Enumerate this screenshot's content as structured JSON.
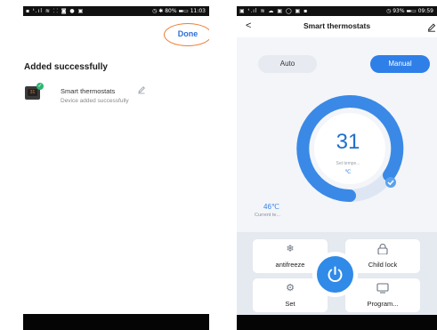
{
  "left_screen": {
    "status_left": "▪ ᵗ.ıl ≋ ⸬ ◙ ● ▣",
    "status_right": "◷ ✱ 80% ▬▭ 11:03",
    "done_label": "Done",
    "title": "Added successfully",
    "device": {
      "thumb_text": "31",
      "name": "Smart thermostats",
      "status": "Device added successfully"
    },
    "accent_color": "#ee7b32",
    "link_color": "#2f6fd6",
    "success_color": "#2bb673"
  },
  "right_screen": {
    "status_left": "▣ ᵗ.ıl ≋ ☁ ▣ ◯ ▣ ▪",
    "status_right": "◷ 93% ▬▭ 09:59",
    "title": "Smart thermostats",
    "modes": {
      "auto": "Auto",
      "manual": "Manual",
      "selected": "Manual"
    },
    "set_temperature": "31",
    "set_label": "Set tempe...",
    "set_unit": "℃",
    "current_temperature": "46℃",
    "current_label": "Current te...",
    "controls": [
      {
        "icon": "snowflake-icon",
        "label": "antifreeze"
      },
      {
        "icon": "lock-icon",
        "label": "Child lock"
      },
      {
        "icon": "gear-icon",
        "label": "Set"
      },
      {
        "icon": "monitor-icon",
        "label": "Program..."
      }
    ],
    "accent_color": "#2f7fe8"
  }
}
